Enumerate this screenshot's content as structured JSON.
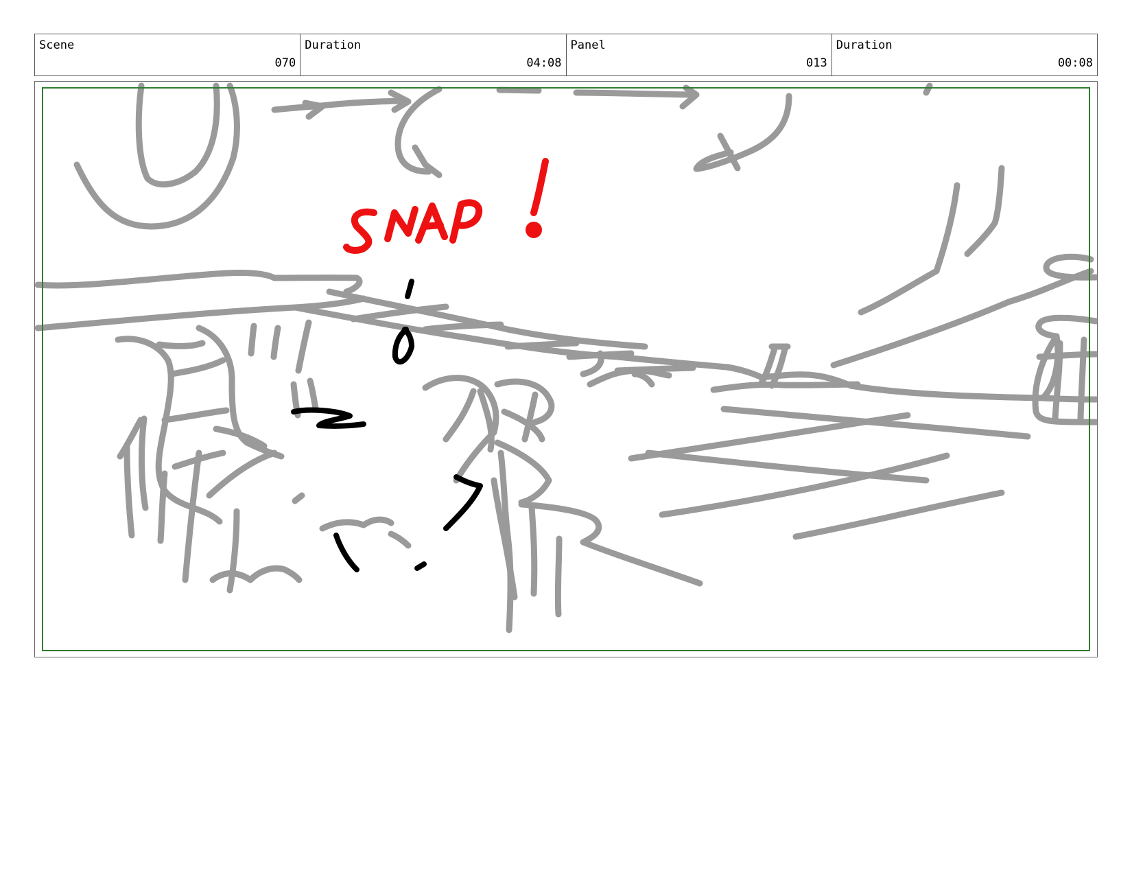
{
  "header": {
    "scene_label": "Scene",
    "scene_value": "070",
    "scene_duration_label": "Duration",
    "scene_duration_value": "04:08",
    "panel_label": "Panel",
    "panel_value": "013",
    "panel_duration_label": "Duration",
    "panel_duration_value": "00:08"
  },
  "panel": {
    "sfx_text": "SNAP!",
    "sfx_color": "#ee1111",
    "sketch_color": "#9a9a9a",
    "ink_color": "#000000",
    "safe_frame_color": "#2f7d2f"
  }
}
